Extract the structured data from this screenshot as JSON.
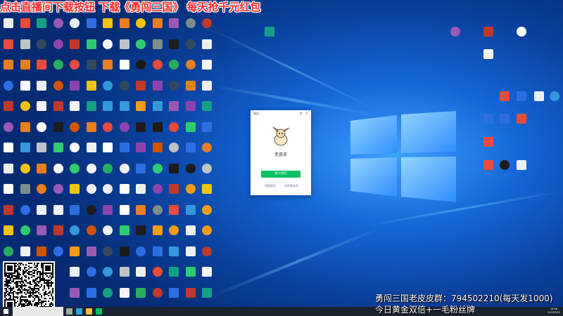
{
  "banner": {
    "text": "点击直播间下载按钮 下载《勇闯三国》 每天抢千元红包",
    "color": "#ff2a2a"
  },
  "overlay": {
    "group_line": "勇闯三国老皮皮群：794502210(每天发1000)",
    "sub_line": "今日黄金双倍+一毛粉丝牌"
  },
  "dialog": {
    "title": "微信",
    "username": "老皮皮",
    "enter_button": "进入微信",
    "switch_account": "切换账号",
    "file_transfer": "仅传输文件",
    "accent": "#07c160"
  },
  "taskbar": {
    "time": "18:56",
    "date": "2023/7/23"
  },
  "colors": {
    "palette": [
      "#f5f5f5",
      "#2d6fe3",
      "#e84c3d",
      "#f1c40f",
      "#2ecc71",
      "#9b59b6",
      "#1c1c1c",
      "#7f8c8d",
      "#e67e22",
      "#ecf0f1",
      "#3498db",
      "#c0392b",
      "#16a085",
      "#ffffff",
      "#d35400",
      "#34495e",
      "#f39c12",
      "#8e44ad",
      "#27ae60",
      "#bdc3c7"
    ]
  }
}
